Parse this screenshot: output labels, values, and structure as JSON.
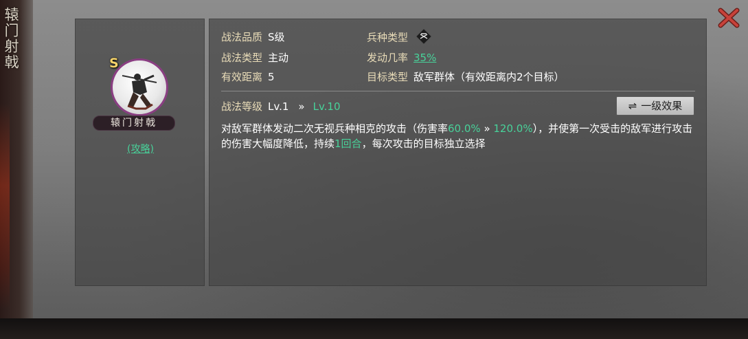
{
  "side_title": "辕门射戟",
  "close_icon": "close-x-icon",
  "skill": {
    "grade_badge": "S",
    "name": "辕门射戟",
    "strategy_link": "(攻略)"
  },
  "details": {
    "quality_label": "战法品质",
    "quality_value": "S级",
    "unit_type_label": "兵种类型",
    "unit_type_icon": "crossbow-unit-icon",
    "skill_type_label": "战法类型",
    "skill_type_value": "主动",
    "trigger_rate_label": "发动几率",
    "trigger_rate_value": "35%",
    "range_label": "有效距离",
    "range_value": "5",
    "target_label": "目标类型",
    "target_value": "敌军群体（有效距离内2个目标）",
    "level_label": "战法等级",
    "level_from": "Lv.1",
    "level_arrow": "»",
    "level_to": "Lv.10",
    "effect_button_icon": "⇌",
    "effect_button_label": "一级效果"
  },
  "description": {
    "part1": "对敌军群体发动二次无视兵种相克的攻击（伤害率",
    "rate_from": "60.0%",
    "rate_arrow": " » ",
    "rate_to": "120.0%",
    "part2": "），并使第一次受击的敌军进行攻击的伤害大幅度降低，持续",
    "duration": "1回合",
    "part3": "，每次攻击的目标独立选择"
  },
  "colors": {
    "accent_green": "#48d29a",
    "label_gold": "#e9dcb8",
    "close_red": "#c8423a",
    "avatar_ring": "#8a3e82"
  }
}
